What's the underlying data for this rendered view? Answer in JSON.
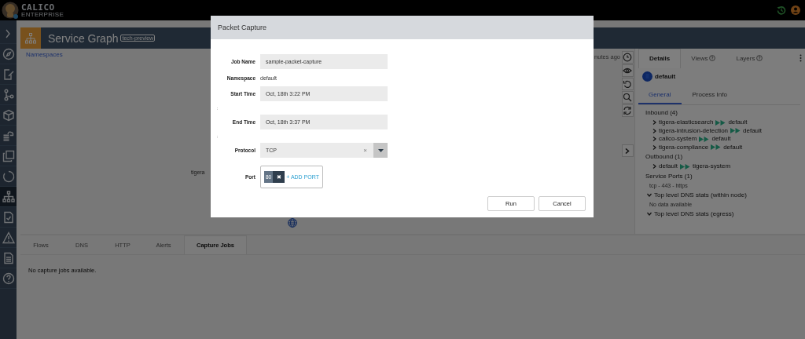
{
  "top_bar": {
    "logo_text": "CALICO",
    "logo_subtext": "ENTERPRISE"
  },
  "sidebar": {
    "items": [
      {
        "kind": "expand",
        "selected": false
      },
      {
        "kind": "compass",
        "selected": false
      },
      {
        "kind": "edit",
        "selected": false
      },
      {
        "kind": "branch",
        "selected": false
      },
      {
        "kind": "cube",
        "selected": false
      },
      {
        "kind": "cloud",
        "selected": false
      },
      {
        "kind": "copy",
        "selected": false
      },
      {
        "kind": "ring",
        "selected": false
      },
      {
        "kind": "sitemap",
        "selected": true
      },
      {
        "kind": "check-file",
        "selected": false
      },
      {
        "kind": "warning",
        "selected": false
      },
      {
        "kind": "list-file",
        "selected": false
      },
      {
        "kind": "help",
        "selected": false
      }
    ]
  },
  "header": {
    "title": "Service Graph",
    "badge": "tech-preview"
  },
  "breadcrumb": "Namespaces",
  "graph": {
    "timestamp": "nutes ago",
    "node_label": "tigera"
  },
  "graph_toolbar": [
    {
      "kind": "clock"
    },
    {
      "kind": "eye"
    },
    {
      "kind": "undo"
    },
    {
      "kind": "search"
    },
    {
      "kind": "refresh"
    }
  ],
  "details_panel": {
    "tabs": [
      {
        "label": "Details",
        "selected": true,
        "help": false
      },
      {
        "label": "Views",
        "selected": false,
        "help": true
      },
      {
        "label": "Layers",
        "selected": false,
        "help": true
      }
    ],
    "namespace": "default",
    "subtabs": [
      {
        "label": "General",
        "selected": true
      },
      {
        "label": "Process Info",
        "selected": false
      }
    ],
    "inbound": {
      "title": "Inbound (4)",
      "items": [
        {
          "source": "tigera-elasticsearch",
          "target": "default"
        },
        {
          "source": "tigera-intrusion-detection",
          "target": "default"
        },
        {
          "source": "calico-system",
          "target": "default"
        },
        {
          "source": "tigera-compliance",
          "target": "default"
        }
      ]
    },
    "outbound": {
      "title": "Outbound (1)",
      "items": [
        {
          "source": "default",
          "target": "tigera-system"
        }
      ]
    },
    "service_ports": {
      "title": "Service Ports (1)",
      "items": [
        "tcp - 443 - https"
      ]
    },
    "dns_sections": [
      {
        "title": "Top level DNS stats (within node)",
        "expanded": true,
        "message": "No data available"
      },
      {
        "title": "Top level DNS stats (egress)",
        "expanded": true
      }
    ]
  },
  "bottom_tabs": [
    {
      "label": "Flows",
      "selected": false
    },
    {
      "label": "DNS",
      "selected": false
    },
    {
      "label": "HTTP",
      "selected": false
    },
    {
      "label": "Alerts",
      "selected": false
    },
    {
      "label": "Capture Jobs",
      "selected": true
    }
  ],
  "bottom_message": "No capture jobs available.",
  "modal": {
    "title": "Packet Capture",
    "job_name": {
      "label": "Job Name",
      "value": "sample-packet-capture"
    },
    "namespace": {
      "label": "Namespace",
      "value": "default"
    },
    "start_time": {
      "label": "Start Time",
      "value": "Oct, 18th 3:22 PM",
      "note": ":"
    },
    "end_time": {
      "label": "End Time",
      "value": "Oct, 18th 3:37 PM",
      "note": ":"
    },
    "protocol": {
      "label": "Protocol",
      "value": "TCP",
      "clear": "×"
    },
    "port": {
      "label": "Port",
      "ports": [
        {
          "value": "80",
          "remove": "✖"
        }
      ],
      "add": "+ ADD PORT"
    },
    "buttons": [
      "Run",
      "Cancel"
    ]
  }
}
